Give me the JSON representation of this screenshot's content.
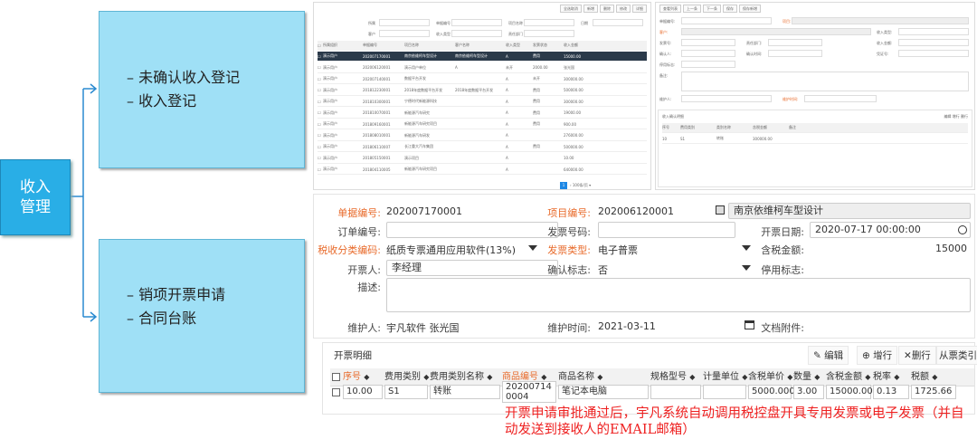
{
  "slide": {
    "main_label": "收入\n管理",
    "group1": [
      "未确认收入登记",
      "收入登记"
    ],
    "group2": [
      "销项开票申请",
      "合同台账"
    ],
    "note": "开票申请审批通过后，宇凡系统自动调用税控盘开具专用发票或电子发票（并自动发送到接收人的EMAIL邮箱）"
  },
  "form": {
    "doc_no_label": "单据编号:",
    "doc_no": "202007170001",
    "project_no_label": "项目编号:",
    "project_no": "202006120001",
    "project_name": "南京依维柯车型设计",
    "order_no_label": "订单编号:",
    "order_no": "",
    "invoice_no_label": "发票号码:",
    "invoice_no": "",
    "invoice_date_label": "开票日期:",
    "invoice_date": "2020-07-17 00:00:00",
    "tax_class_label": "税收分类编码:",
    "tax_class": "纸质专票通用应用软件(13%)",
    "invoice_type_label": "发票类型:",
    "invoice_type": "电子普票",
    "amount_label": "含税金额:",
    "amount": "15000",
    "issuer_label": "开票人:",
    "issuer": "李经理",
    "confirm_label": "确认标志:",
    "confirm": "否",
    "disabled_label": "停用标志:",
    "disabled": "",
    "desc_label": "描述:",
    "maintainer_label": "维护人:",
    "maintainer": "宇凡软件 张光国",
    "maint_time_label": "维护时间:",
    "maint_time": "2021-03-11",
    "attach_label": "文档附件:"
  },
  "detail": {
    "title": "开票明细",
    "buttons": [
      "编辑",
      "增行",
      "删行",
      "从票类引入"
    ],
    "columns": [
      "序号",
      "费用类别",
      "费用类别名称",
      "商品编号",
      "商品名称",
      "规格型号",
      "计量单位",
      "含税单价",
      "数量",
      "含税金额",
      "税率",
      "税额"
    ],
    "row": {
      "seq": "10.00",
      "fee_cat": "S1",
      "fee_cat_name": "转账",
      "goods_no": "202007140004",
      "goods_name": "笔记本电脑",
      "spec": "",
      "unit": "",
      "unit_price": "5000.0000",
      "qty": "3.00",
      "amount": "15000.00",
      "tax_rate": "0.13",
      "tax": "1725.66"
    }
  },
  "mini": {
    "toolbar1": [
      "全选取消",
      "新增",
      "删除",
      "修改",
      "详细"
    ],
    "toolbar2": [
      "查看列表",
      "上一条",
      "下一条",
      "保存",
      "保存新增"
    ],
    "list_rows": [
      [
        "演示用户",
        "202007170001",
        "南京依维柯车型设计",
        "南京依维柯车型设计",
        "A",
        "费用",
        "15000.00"
      ],
      [
        "演示用户",
        "202006120001",
        "演示用户单位",
        "A",
        "未开",
        "2000.00",
        "张光国"
      ],
      [
        "演示用户",
        "202007140001",
        "数据平台开发",
        "",
        "A",
        "未开",
        "300000.00"
      ],
      [
        "演示用户",
        "201812230001",
        "2018年度数据平台开发",
        "2018年度数据平台开发",
        "A",
        "费用",
        "500000.00"
      ],
      [
        "演示用户",
        "201810300001",
        "宁德时代新能源科技",
        "",
        "A",
        "费用",
        "300000.00"
      ],
      [
        "演示用户",
        "201810070001",
        "新能源汽车研究",
        "",
        "A",
        "费用",
        "19000.00"
      ],
      [
        "演示用户",
        "201809160001",
        "新能源汽车研究项目",
        "",
        "A",
        "费用",
        "900.00"
      ],
      [
        "演示用户",
        "201808010001",
        "新能源汽车研发",
        "",
        "A",
        "",
        "276000.00"
      ],
      [
        "演示用户",
        "201806110007",
        "长江重大汽车集团",
        "",
        "A",
        "费用",
        "500000.00"
      ],
      [
        "演示用户",
        "201805150001",
        "演示项目",
        "",
        "A",
        "",
        "10.00"
      ],
      [
        "演示用户",
        "201804110005",
        "新能源汽车研究项目",
        "",
        "A",
        "",
        "640000.00"
      ]
    ],
    "list_headers": [
      "所属组织",
      "单据编号",
      "项目名称",
      "客户名称",
      "收入类型",
      "发票状态",
      "收入金额"
    ]
  },
  "colors": {
    "accent": "#29aee6",
    "red": "#ee2020",
    "orange": "#e86a2a",
    "box": "#9fe0f6"
  }
}
